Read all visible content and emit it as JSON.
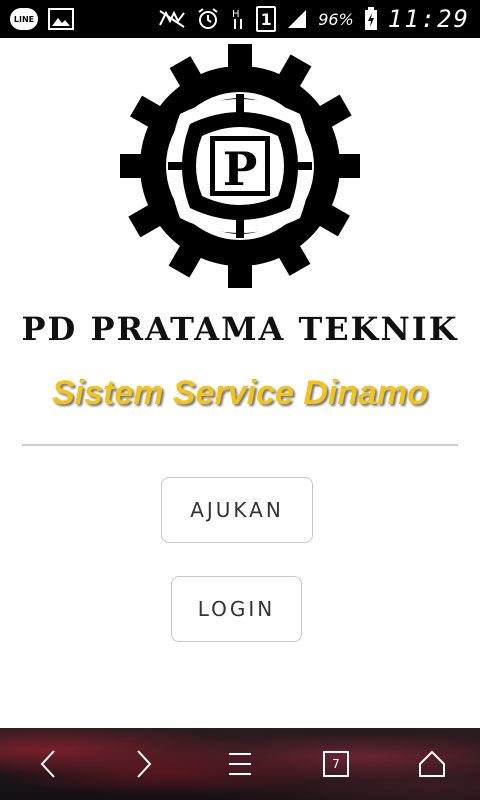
{
  "statusbar": {
    "app_badge": "LINE",
    "sim_label": "1",
    "battery": "96%",
    "time": "11:29"
  },
  "logo": {
    "letter": "P"
  },
  "company_name": "PD PRATAMA TEKNIK",
  "subtitle": "Sistem Service Dinamo",
  "buttons": {
    "ajukan": "AJUKAN",
    "login": "LOGIN"
  },
  "navbar": {
    "tabs_count": "7"
  },
  "colors": {
    "subtitle_gold": "#f2c21d",
    "statusbar_bg": "#000000"
  }
}
